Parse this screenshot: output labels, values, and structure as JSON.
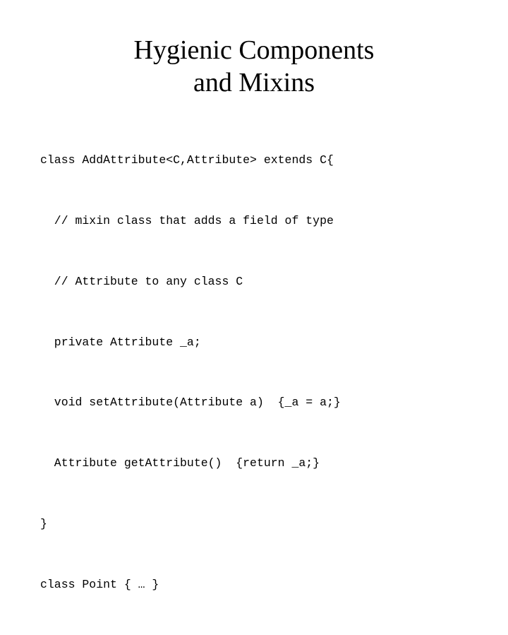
{
  "slide": {
    "title_line_1": "Hygienic Components",
    "title_line_2": "and Mixins",
    "title_full": "Hygienic Components\nand Mixins",
    "background_color": "#ffffff",
    "text_color": "#000000",
    "code": {
      "language": "java-like",
      "lines": [
        "class AddAttribute<C,Attribute> extends C{",
        "  // mixin class that adds a field of type",
        "  // Attribute to any class C",
        "  private Attribute _a;",
        "  void setAttribute(Attribute a)  {_a = a;}",
        "  Attribute getAttribute()  {return _a;}",
        "}",
        "class Point { … }"
      ],
      "full_text": "class AddAttribute<C,Attribute> extends C{\n  // mixin class that adds a field of type\n  // Attribute to any class C\n  private Attribute _a;\n  void setAttribute(Attribute a)  {_a = a;}\n  Attribute getAttribute()  {return _a;}\n}\nclass Point { … }"
    }
  }
}
